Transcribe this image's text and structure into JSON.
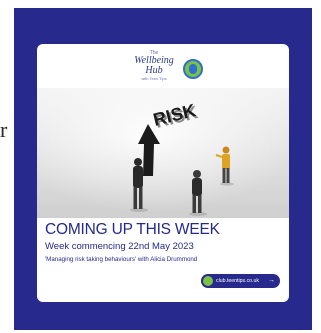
{
  "page_edge_text": "r",
  "post": {
    "logo": {
      "line1": "The",
      "line2": "Wellbeing",
      "line3": "Hub",
      "line4": "with Teen Tips",
      "badge_icon": "wellbeing-hub-badge-icon"
    },
    "image_text": "RISK",
    "headline": "COMING UP THIS WEEK",
    "subhead": "Week commencing 22nd May 2023",
    "detail": "'Managing risk taking behaviours' with Alicia Drummond",
    "link": {
      "label": "club.teentips.co.uk",
      "arrow": "→",
      "icon": "globe-icon"
    },
    "colors": {
      "brand_navy": "#272a8c",
      "text_navy": "#232a8a",
      "accent_green": "#7cc242",
      "accent_blue": "#2e6fd1"
    }
  }
}
